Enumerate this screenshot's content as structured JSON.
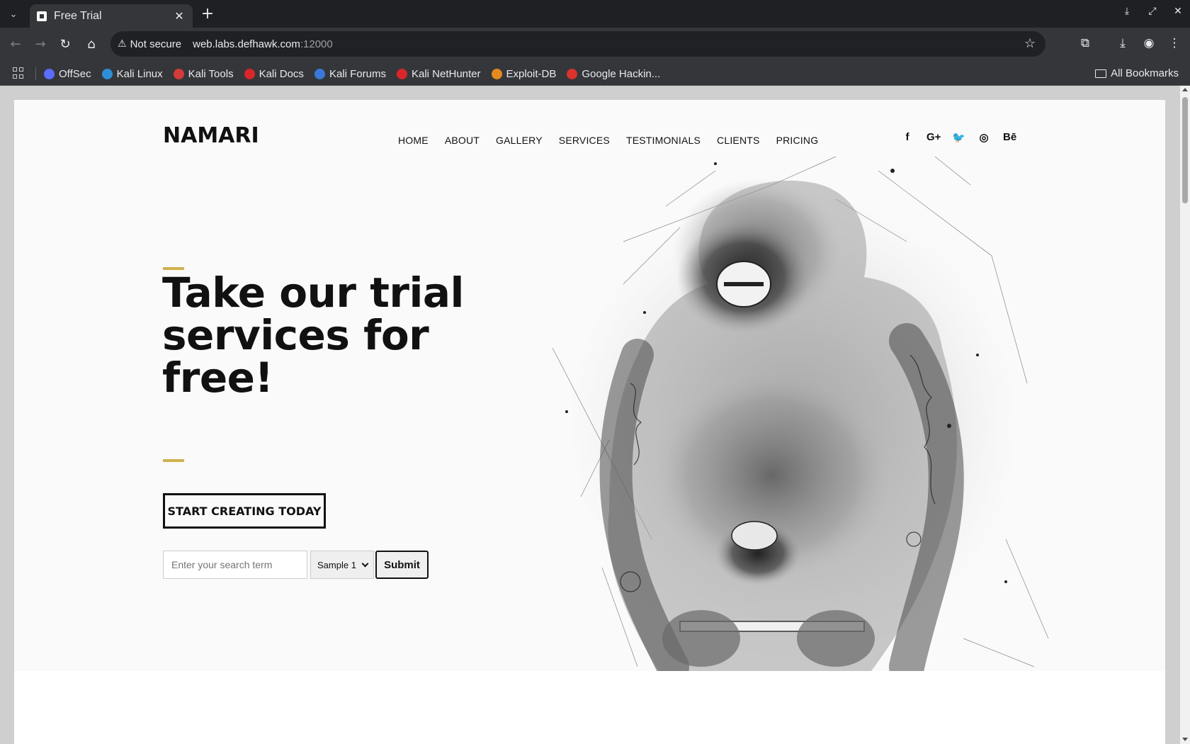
{
  "browser": {
    "tab_title": "Free Trial",
    "security_label": "Not secure",
    "url_host": "web.labs.defhawk.com",
    "url_port": ":12000",
    "bookmarks": [
      {
        "label": "OffSec",
        "color": "#5b6cff"
      },
      {
        "label": "Kali Linux",
        "color": "#2f8fd6"
      },
      {
        "label": "Kali Tools",
        "color": "#d33b3b"
      },
      {
        "label": "Kali Docs",
        "color": "#d9262b"
      },
      {
        "label": "Kali Forums",
        "color": "#3a78d8"
      },
      {
        "label": "Kali NetHunter",
        "color": "#d9262b"
      },
      {
        "label": "Exploit-DB",
        "color": "#e58a1f"
      },
      {
        "label": "Google Hackin...",
        "color": "#d9332b"
      }
    ],
    "all_bookmarks": "All Bookmarks"
  },
  "site": {
    "logo": "NAMARI",
    "nav": [
      "HOME",
      "ABOUT",
      "GALLERY",
      "SERVICES",
      "TESTIMONIALS",
      "CLIENTS",
      "PRICING"
    ],
    "social": [
      {
        "icon": "facebook-icon",
        "glyph": "f"
      },
      {
        "icon": "google-plus-icon",
        "glyph": "G+"
      },
      {
        "icon": "twitter-icon",
        "glyph": "🐦"
      },
      {
        "icon": "instagram-icon",
        "glyph": "◎"
      },
      {
        "icon": "behance-icon",
        "glyph": "Bē"
      }
    ],
    "accent_color": "#d0b050",
    "headline": "Take our trial services for free!",
    "cta": "START CREATING TODAY",
    "search": {
      "placeholder": "Enter your search term",
      "value": "",
      "select_value": "Sample 1",
      "submit": "Submit"
    }
  }
}
